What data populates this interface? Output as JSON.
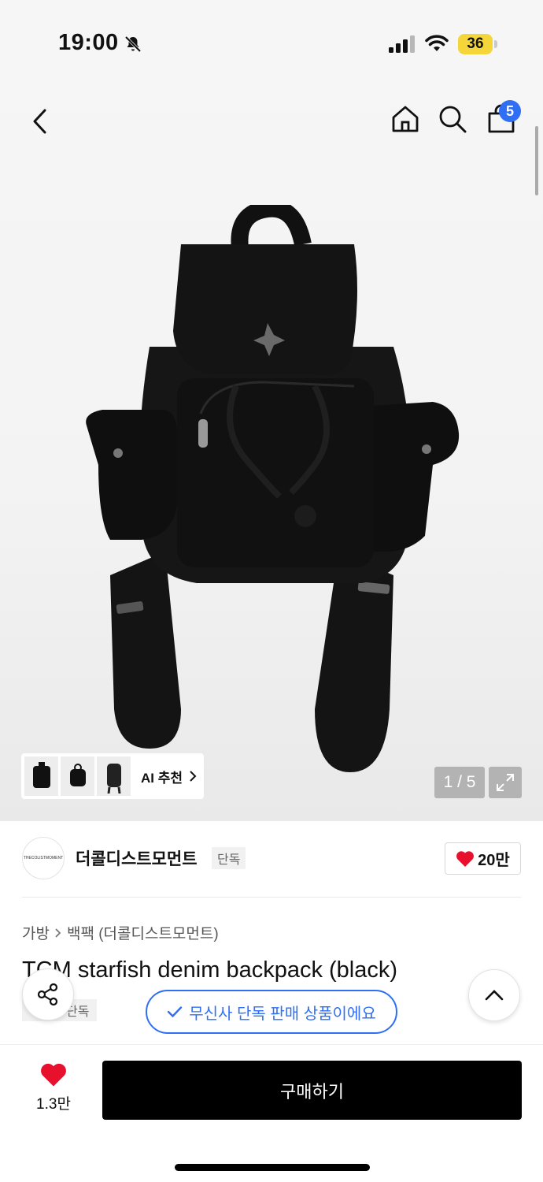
{
  "status_bar": {
    "time": "19:00",
    "battery": "36"
  },
  "header": {
    "cart_count": "5"
  },
  "gallery": {
    "counter": "1 / 5",
    "ai_recommend_label": "AI 추천"
  },
  "brand": {
    "logo_text": "THECOLISTMOMENT",
    "name": "더콜디스트모먼트",
    "badge": "단독",
    "like_count": "20만"
  },
  "product": {
    "breadcrumb": [
      "가방",
      "백팩 (더콜디스트모먼트)"
    ],
    "title": "TCM starfish denim backpack (black)",
    "tag": "단독"
  },
  "toast": {
    "text": "무신사 단독 판매 상품이에요"
  },
  "bottom_bar": {
    "like_count": "1.3만",
    "buy_label": "구매하기"
  },
  "colors": {
    "accent": "#2f6ff5",
    "like": "#e8112d",
    "battery": "#f4d63a"
  },
  "icons": [
    "bell-off-icon",
    "signal-icon",
    "wifi-icon",
    "back-icon",
    "home-icon",
    "search-icon",
    "cart-icon",
    "chevron-right-icon",
    "expand-icon",
    "heart-icon",
    "share-icon",
    "check-icon",
    "chevron-up-icon"
  ]
}
